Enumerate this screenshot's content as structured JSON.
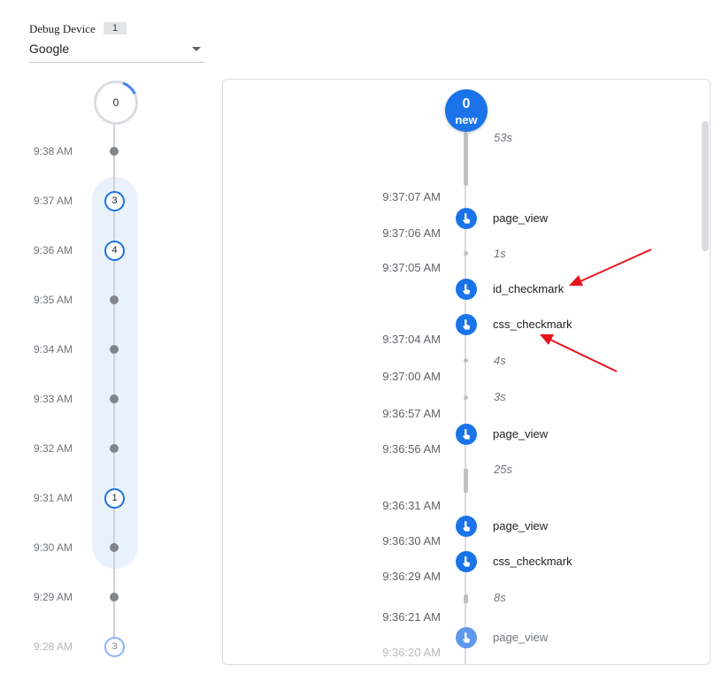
{
  "device": {
    "label": "Debug Device",
    "count": "1",
    "selected": "Google"
  },
  "minutes": {
    "top_count": "0",
    "rows": [
      {
        "time": "9:38 AM",
        "count": null
      },
      {
        "time": "9:37 AM",
        "count": "3"
      },
      {
        "time": "9:36 AM",
        "count": "4"
      },
      {
        "time": "9:35 AM",
        "count": null
      },
      {
        "time": "9:34 AM",
        "count": null
      },
      {
        "time": "9:33 AM",
        "count": null
      },
      {
        "time": "9:32 AM",
        "count": null
      },
      {
        "time": "9:31 AM",
        "count": "1"
      },
      {
        "time": "9:30 AM",
        "count": null
      },
      {
        "time": "9:29 AM",
        "count": null
      },
      {
        "time": "9:28 AM",
        "count": "3"
      }
    ]
  },
  "seconds": {
    "new_count": "0",
    "new_label": "new",
    "timestamps": [
      "9:37:07 AM",
      "9:37:06 AM",
      "9:37:05 AM",
      "9:37:04 AM",
      "9:37:00 AM",
      "9:36:57 AM",
      "9:36:56 AM",
      "9:36:31 AM",
      "9:36:30 AM",
      "9:36:29 AM",
      "9:36:21 AM",
      "9:36:20 AM"
    ],
    "durations": [
      "53s",
      "1s",
      "4s",
      "3s",
      "25s",
      "8s"
    ],
    "events": [
      "page_view",
      "id_checkmark",
      "css_checkmark",
      "page_view",
      "page_view",
      "css_checkmark",
      "page_view"
    ]
  },
  "colors": {
    "accent": "#1a73e8",
    "annotation_arrow": "#e8141b"
  }
}
